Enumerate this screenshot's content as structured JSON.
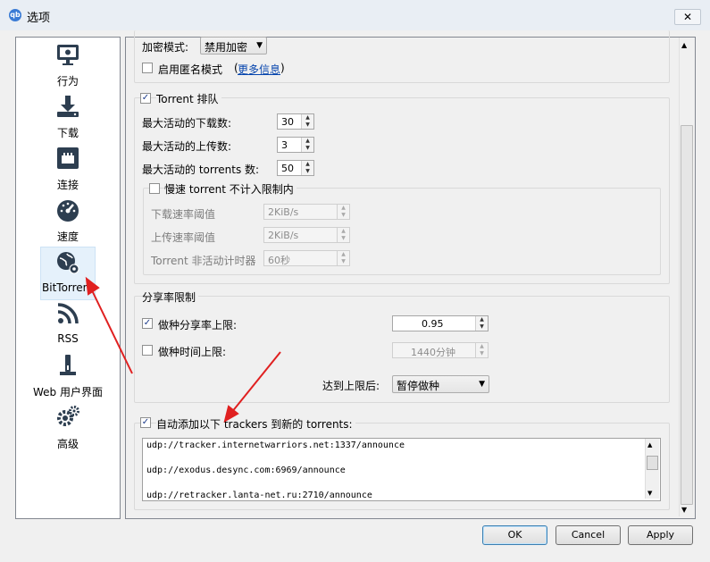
{
  "window": {
    "title": "选项",
    "app_icon": "qb",
    "close_glyph": "✕"
  },
  "sidebar": {
    "items": [
      {
        "label": "行为",
        "icon": "monitor-icon"
      },
      {
        "label": "下载",
        "icon": "download-icon"
      },
      {
        "label": "连接",
        "icon": "network-icon"
      },
      {
        "label": "速度",
        "icon": "speedometer-icon"
      },
      {
        "label": "BitTorrent",
        "icon": "bittorrent-globe-icon",
        "selected": true
      },
      {
        "label": "RSS",
        "icon": "rss-icon"
      },
      {
        "label": "Web 用户界面",
        "icon": "web-ui-icon"
      },
      {
        "label": "高级",
        "icon": "gears-icon"
      }
    ]
  },
  "encryption": {
    "label": "加密模式:",
    "value": "禁用加密"
  },
  "anonymous": {
    "label": "启用匿名模式",
    "link": "更多信息",
    "open": "(",
    "close": ")",
    "checked": false
  },
  "queue": {
    "title": "Torrent 排队",
    "checked": true,
    "max_downloads": {
      "label": "最大活动的下载数:",
      "value": "30"
    },
    "max_uploads": {
      "label": "最大活动的上传数:",
      "value": "3"
    },
    "max_torrents": {
      "label": "最大活动的 torrents 数:",
      "value": "50"
    },
    "slow": {
      "title": "慢速 torrent 不计入限制内",
      "checked": false,
      "dl_threshold": {
        "label": "下载速率阈值",
        "value": "2KiB/s"
      },
      "ul_threshold": {
        "label": "上传速率阈值",
        "value": "2KiB/s"
      },
      "inactivity": {
        "label": "Torrent 非活动计时器",
        "value": "60秒"
      }
    }
  },
  "ratio": {
    "title": "分享率限制",
    "share_ratio": {
      "label": "做种分享率上限:",
      "value": "0.95",
      "checked": true
    },
    "seed_time": {
      "label": "做种时间上限:",
      "value": "1440分钟",
      "checked": false
    },
    "action": {
      "label": "达到上限后:",
      "value": "暂停做种"
    }
  },
  "trackers": {
    "title": "自动添加以下 trackers 到新的 torrents:",
    "checked": true,
    "lines": [
      "udp://tracker.internetwarriors.net:1337/announce",
      "udp://exodus.desync.com:6969/announce",
      "udp://retracker.lanta-net.ru:2710/announce"
    ]
  },
  "buttons": {
    "ok": "OK",
    "cancel": "Cancel",
    "apply": "Apply"
  },
  "colors": {
    "accent": "#3a7bd5",
    "annotation_arrow": "#e02020",
    "selection": "#e5f1fb"
  }
}
